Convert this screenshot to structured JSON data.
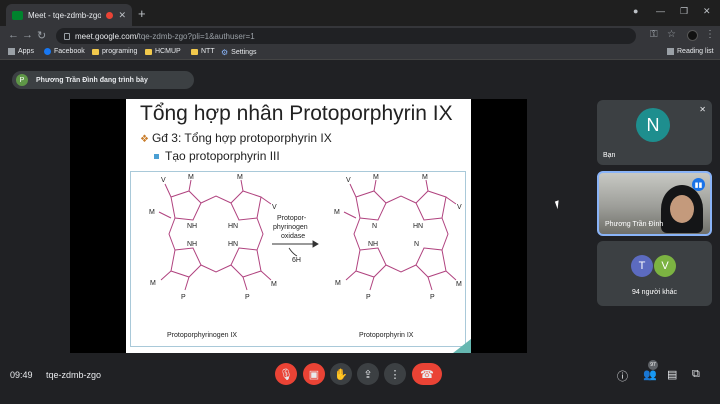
{
  "browser": {
    "tab_title": "Meet - tqe-zdmb-zgo",
    "url_host": "meet.google.com/",
    "url_path": "tqe-zdmb-zgo?pli=1&authuser=1",
    "bookmarks": [
      "Apps",
      "Facebook",
      "programing",
      "HCMUP",
      "NTT",
      "Settings"
    ],
    "reading_list": "Reading list"
  },
  "meet": {
    "presenting_initial": "P",
    "presenting_text": "Phương Trần Đình đang trình bày",
    "slide": {
      "title": "Tổng hợp nhân Protoporphyrin IX",
      "bullet1": "Gđ 3: Tổng hợp protoporphyrin IX",
      "bullet2": "Tạo protoporphyrin III",
      "figure": {
        "left_label": "Protoporphyrinogen IX",
        "right_label": "Protoporphyrin IX",
        "enzyme_line1": "Protopor-",
        "enzyme_line2": "phyrinogen",
        "enzyme_line3": "oxidase",
        "arrow_below": "6H",
        "sub_V": "V",
        "sub_M": "M",
        "sub_P": "P",
        "NH": "NH",
        "HN": "HN",
        "N": "N"
      }
    },
    "participants": [
      {
        "initial": "N",
        "name": "Bạn",
        "color": "#1e8e8e"
      },
      {
        "name": "Phương Trần Đình"
      },
      {
        "name": "94 người khác",
        "initials": [
          "T",
          "V"
        ],
        "colors": [
          "#5c6bc0",
          "#7cb342"
        ]
      }
    ],
    "time": "09:49",
    "meeting_code": "tqe-zdmb-zgo",
    "people_count": "97"
  }
}
